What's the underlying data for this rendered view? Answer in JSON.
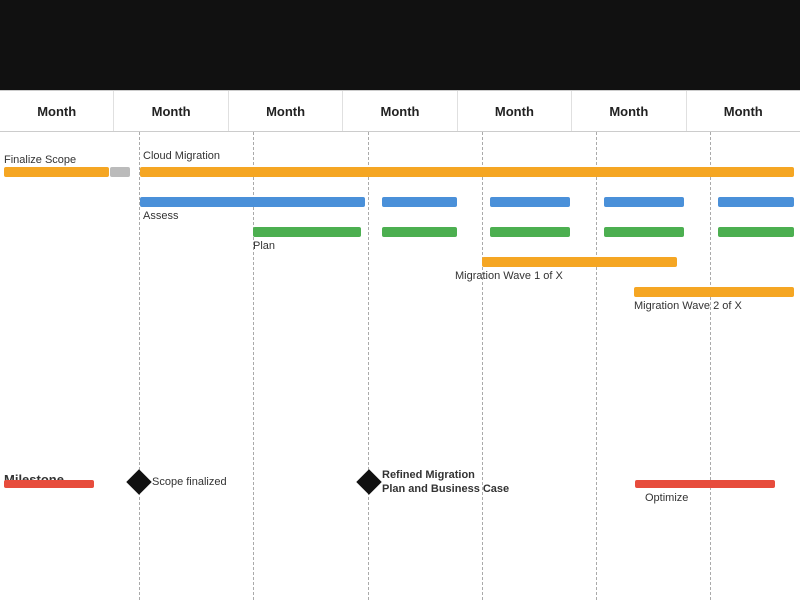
{
  "header": {
    "months": [
      "Month",
      "Month",
      "Month",
      "Month",
      "Month",
      "Month",
      "Month"
    ]
  },
  "labels": {
    "finalize_scope": "Finalize Scope",
    "cloud_migration": "Cloud Migration",
    "assess": "Assess",
    "plan": "Plan",
    "wave1": "Migration Wave 1 of X",
    "wave2": "Migration Wave 2 of X",
    "milestone": "Milestone",
    "scope_finalized": "Scope finalized",
    "refined_migration": "Refined Migration",
    "plan_business": "Plan and Business Case",
    "optimize": "Optimize"
  },
  "colors": {
    "orange": "#F5A623",
    "blue": "#4A90D9",
    "green": "#4CAF50",
    "red": "#E74C3C",
    "dark": "#111111"
  }
}
